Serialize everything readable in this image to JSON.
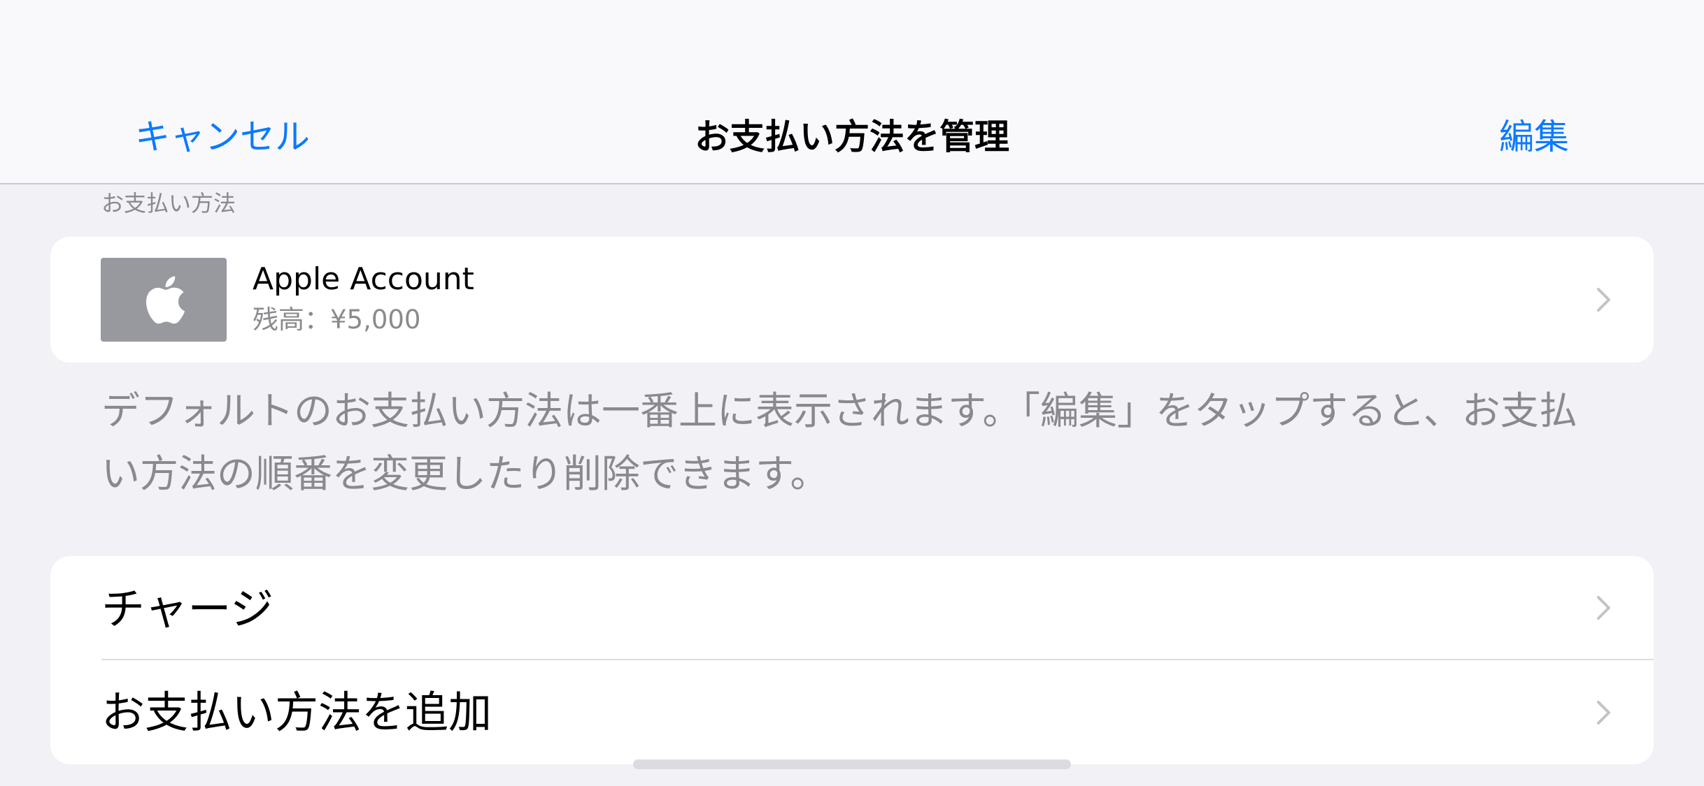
{
  "nav": {
    "cancel_label": "キャンセル",
    "title": "お支払い方法を管理",
    "edit_label": "編集"
  },
  "payment_section": {
    "header": "お支払い方法",
    "account": {
      "icon": "apple-logo-icon",
      "name": "Apple Account",
      "balance": "残高：¥5,000"
    },
    "footnote": "デフォルトのお支払い方法は一番上に表示されます。「編集」をタップすると、お支払い方法の順番を変更したり削除できます。"
  },
  "actions": [
    {
      "label": "チャージ"
    },
    {
      "label": "お支払い方法を追加"
    }
  ],
  "colors": {
    "accent": "#0a7aff",
    "background": "#f2f1f6",
    "secondary_text": "#8a8a8e",
    "card": "#ffffff",
    "thumbnail": "#98999e"
  }
}
